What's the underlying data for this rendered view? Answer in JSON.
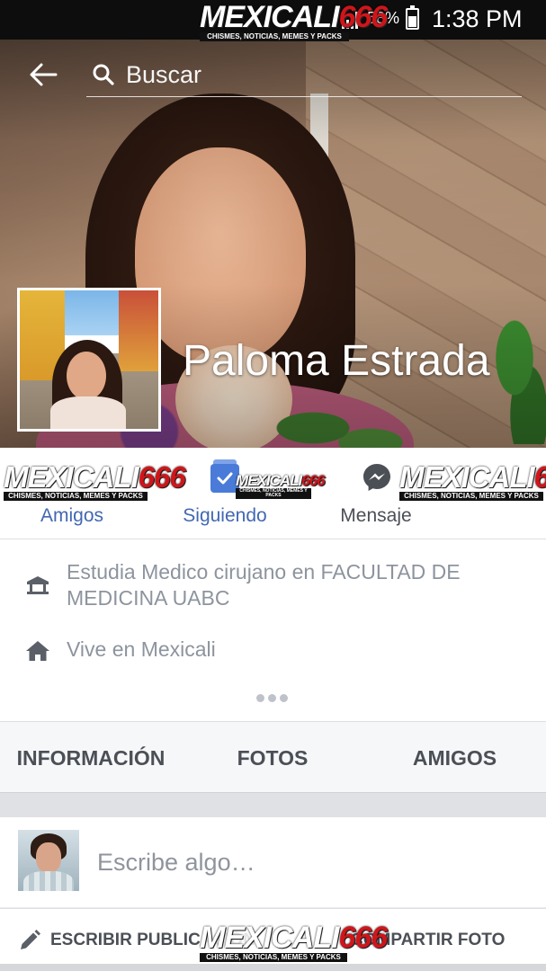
{
  "status_bar": {
    "battery": "58%",
    "time": "1:38 PM"
  },
  "header": {
    "search_placeholder": "Buscar"
  },
  "profile": {
    "name": "Paloma Estrada"
  },
  "actions": {
    "friends": "Amigos",
    "following": "Siguiendo",
    "message": "Mensaje"
  },
  "info": {
    "study": "Estudia Medico cirujano en FACULTAD DE MEDICINA UABC",
    "lives": "Vive en Mexicali"
  },
  "tabs": [
    "INFORMACIÓN",
    "FOTOS",
    "AMIGOS"
  ],
  "composer": {
    "placeholder": "Escribe algo…",
    "write_post": "ESCRIBIR PUBLICACIÓN",
    "share_photo": "COMPARTIR FOTO"
  },
  "watermark": {
    "brand": "MEXICALI",
    "number": "666",
    "tagline": "CHISMES, NOTICIAS, MEMES Y PACKS"
  }
}
